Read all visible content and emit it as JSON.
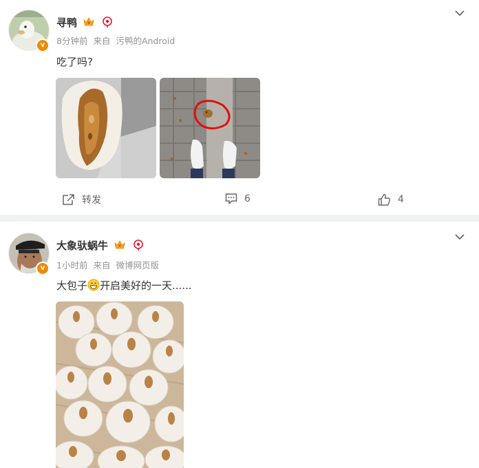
{
  "posts": [
    {
      "username": "寻鸭",
      "time": "8分钟前",
      "from_label": "来自",
      "source": "污鸭的Android",
      "text": "吃了吗?",
      "actions": {
        "repost_label": "转发",
        "comments": "6",
        "likes": "4"
      }
    },
    {
      "username": "大象驮蜗牛",
      "time": "1小时前",
      "from_label": "来自",
      "source": "微博网页版",
      "text_before": "大包子",
      "text_after": "开启美好的一天......"
    }
  ],
  "colors": {
    "badge": "#f08a00",
    "divider": "#f1f2f5",
    "meta": "#939393",
    "annotation": "#e01010"
  },
  "icons": [
    "chevron-down-icon",
    "crown-icon",
    "pin-icon",
    "verified-icon",
    "share-icon",
    "comment-icon",
    "like-icon",
    "grin-emoji-icon"
  ]
}
